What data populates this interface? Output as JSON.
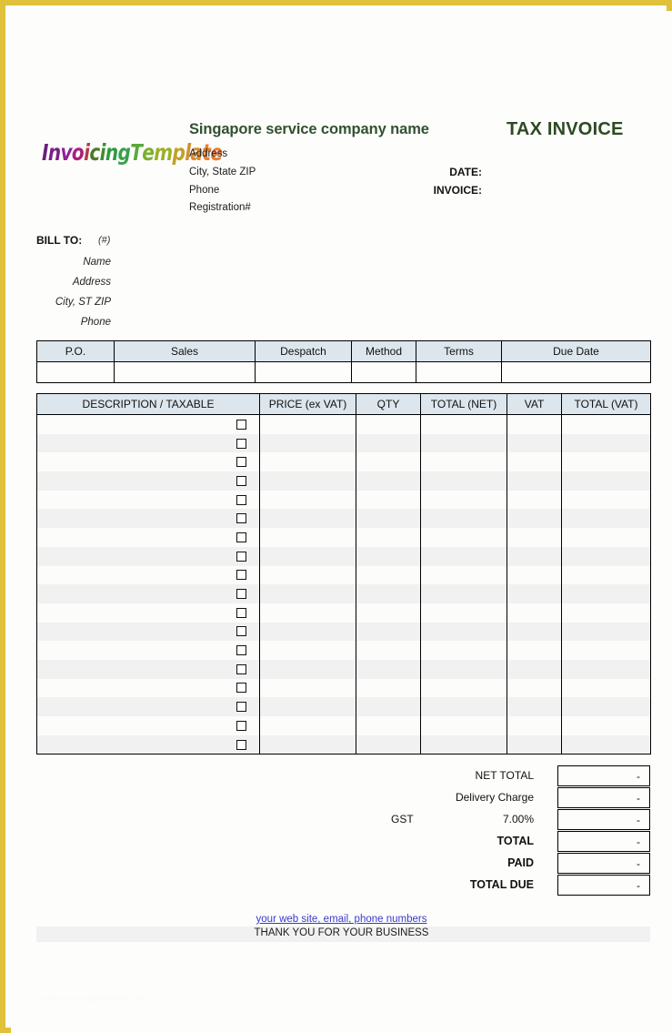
{
  "page": {
    "border_color": "#e0c13a",
    "background": "#fdfdfb"
  },
  "header": {
    "logo": {
      "name": "InvoicingTemplate",
      "letters": [
        {
          "ch": "I",
          "color": "#6b1f7a"
        },
        {
          "ch": "n",
          "color": "#7a1f8a"
        },
        {
          "ch": "v",
          "color": "#8f1f9a"
        },
        {
          "ch": "o",
          "color": "#a8207a"
        },
        {
          "ch": "i",
          "color": "#b33a4a"
        },
        {
          "ch": "c",
          "color": "#4a7a2a"
        },
        {
          "ch": "i",
          "color": "#3f8a2f"
        },
        {
          "ch": "n",
          "color": "#2f9a3f"
        },
        {
          "ch": "g",
          "color": "#3aa04a"
        },
        {
          "ch": "T",
          "color": "#5aa83a"
        },
        {
          "ch": "e",
          "color": "#7ab02f"
        },
        {
          "ch": "m",
          "color": "#9bb02a"
        },
        {
          "ch": "p",
          "color": "#c0a02a"
        },
        {
          "ch": "l",
          "color": "#d4902a"
        },
        {
          "ch": "a",
          "color": "#e08a2a"
        },
        {
          "ch": "t",
          "color": "#e88030"
        },
        {
          "ch": "e",
          "color": "#ef7a34"
        }
      ]
    },
    "company_name": "Singapore service company name",
    "company_name_color": "#315131",
    "title": "TAX INVOICE",
    "title_color": "#2d4a22",
    "company_lines": [
      "Address",
      "City, State ZIP",
      "Phone",
      "Registration#"
    ],
    "meta_labels": [
      "DATE:",
      "INVOICE:"
    ]
  },
  "bill_to": {
    "title": "BILL TO:",
    "hash": "(#)",
    "lines": [
      "Name",
      "Address",
      "City, ST ZIP",
      "Phone"
    ]
  },
  "info_table": {
    "headers": [
      "P.O.",
      "Sales",
      "Despatch",
      "Method",
      "Terms",
      "Due Date"
    ],
    "values": [
      "",
      "",
      "",
      "",
      "",
      ""
    ]
  },
  "items_table": {
    "headers": [
      "DESCRIPTION / TAXABLE",
      "PRICE (ex VAT)",
      "QTY",
      "TOTAL (NET)",
      "VAT",
      "TOTAL (VAT)"
    ],
    "row_count": 18,
    "rows": [
      {
        "description": "",
        "taxable": false,
        "price": "",
        "qty": "",
        "total_net": "",
        "vat": "",
        "total_vat": ""
      },
      {
        "description": "",
        "taxable": false,
        "price": "",
        "qty": "",
        "total_net": "",
        "vat": "",
        "total_vat": ""
      },
      {
        "description": "",
        "taxable": false,
        "price": "",
        "qty": "",
        "total_net": "",
        "vat": "",
        "total_vat": ""
      },
      {
        "description": "",
        "taxable": false,
        "price": "",
        "qty": "",
        "total_net": "",
        "vat": "",
        "total_vat": ""
      },
      {
        "description": "",
        "taxable": false,
        "price": "",
        "qty": "",
        "total_net": "",
        "vat": "",
        "total_vat": ""
      },
      {
        "description": "",
        "taxable": false,
        "price": "",
        "qty": "",
        "total_net": "",
        "vat": "",
        "total_vat": ""
      },
      {
        "description": "",
        "taxable": false,
        "price": "",
        "qty": "",
        "total_net": "",
        "vat": "",
        "total_vat": ""
      },
      {
        "description": "",
        "taxable": false,
        "price": "",
        "qty": "",
        "total_net": "",
        "vat": "",
        "total_vat": ""
      },
      {
        "description": "",
        "taxable": false,
        "price": "",
        "qty": "",
        "total_net": "",
        "vat": "",
        "total_vat": ""
      },
      {
        "description": "",
        "taxable": false,
        "price": "",
        "qty": "",
        "total_net": "",
        "vat": "",
        "total_vat": ""
      },
      {
        "description": "",
        "taxable": false,
        "price": "",
        "qty": "",
        "total_net": "",
        "vat": "",
        "total_vat": ""
      },
      {
        "description": "",
        "taxable": false,
        "price": "",
        "qty": "",
        "total_net": "",
        "vat": "",
        "total_vat": ""
      },
      {
        "description": "",
        "taxable": false,
        "price": "",
        "qty": "",
        "total_net": "",
        "vat": "",
        "total_vat": ""
      },
      {
        "description": "",
        "taxable": false,
        "price": "",
        "qty": "",
        "total_net": "",
        "vat": "",
        "total_vat": ""
      },
      {
        "description": "",
        "taxable": false,
        "price": "",
        "qty": "",
        "total_net": "",
        "vat": "",
        "total_vat": ""
      },
      {
        "description": "",
        "taxable": false,
        "price": "",
        "qty": "",
        "total_net": "",
        "vat": "",
        "total_vat": ""
      },
      {
        "description": "",
        "taxable": false,
        "price": "",
        "qty": "",
        "total_net": "",
        "vat": "",
        "total_vat": ""
      },
      {
        "description": "",
        "taxable": false,
        "price": "",
        "qty": "",
        "total_net": "",
        "vat": "",
        "total_vat": ""
      }
    ]
  },
  "totals": [
    {
      "label": "NET TOTAL",
      "bold": false,
      "prefix": "",
      "value": "-"
    },
    {
      "label": "Delivery Charge",
      "bold": false,
      "prefix": "",
      "value": "-"
    },
    {
      "label": "7.00%",
      "bold": false,
      "prefix": "GST",
      "value": "-"
    },
    {
      "label": "TOTAL",
      "bold": true,
      "prefix": "",
      "value": "-"
    },
    {
      "label": "PAID",
      "bold": true,
      "prefix": "",
      "value": "-"
    },
    {
      "label": "TOTAL DUE",
      "bold": true,
      "prefix": "",
      "value": "-"
    }
  ],
  "footer": {
    "link": "your web site, email, phone numbers",
    "link_color": "#3a3ad0",
    "thanks": "THANK YOU FOR YOUR BUSINESS",
    "watermark": "www.invoicingtemplate.com"
  },
  "theme": {
    "header_fill": "#dce6ec",
    "row_stripe": "#f1f1f1",
    "row_base": "#fcfcfa",
    "grid_line": "#000000"
  }
}
